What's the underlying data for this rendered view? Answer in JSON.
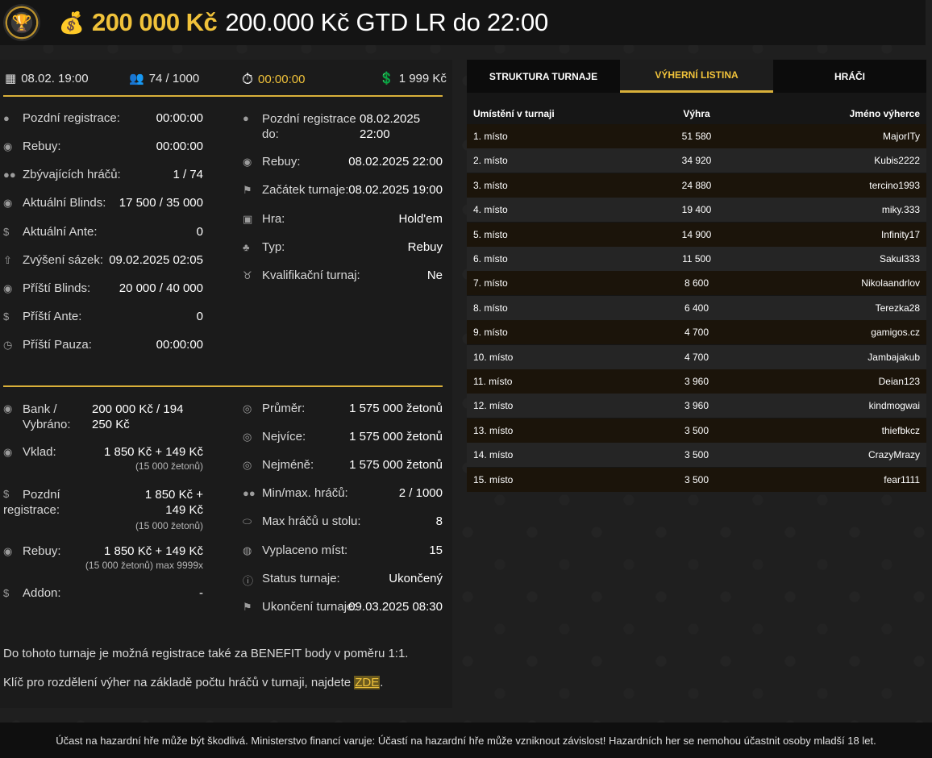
{
  "header": {
    "prize": "200 000 Kč",
    "name": "200.000 Kč GTD LR do 22:00"
  },
  "top": {
    "date": "08.02. 19:00",
    "players": "74 / 1000",
    "timer": "00:00:00",
    "buyin": "1 999 Kč"
  },
  "col1": [
    {
      "label": "Pozdní registrace:",
      "value": "00:00:00",
      "icon": "user-icon"
    },
    {
      "label": "Rebuy:",
      "value": "00:00:00",
      "icon": "coins-icon"
    },
    {
      "label": "Zbývajících hráčů:",
      "value": "1 / 74",
      "icon": "users-icon"
    },
    {
      "label": "Aktuální Blinds:",
      "value": "17 500 / 35 000",
      "icon": "coins-icon"
    },
    {
      "label": "Aktuální Ante:",
      "value": "0",
      "icon": "dollar-icon"
    },
    {
      "label": "Zvýšení sázek:",
      "value": "09.02.2025 02:05",
      "icon": "arrow-up-icon"
    },
    {
      "label": "Příští Blinds:",
      "value": "20 000 / 40 000",
      "icon": "coins-icon"
    },
    {
      "label": "Příští Ante:",
      "value": "0",
      "icon": "dollar-icon"
    },
    {
      "label": "Příští Pauza:",
      "value": "00:00:00",
      "icon": "clock-icon"
    }
  ],
  "col2": [
    {
      "label": "Pozdní registrace do:",
      "value": "08.02.2025 22:00",
      "icon": "user-icon"
    },
    {
      "label": "Rebuy:",
      "value": "08.02.2025 22:00",
      "icon": "coins-icon"
    },
    {
      "label": "Začátek turnaje:",
      "value": "08.02.2025 19:00",
      "icon": "flag-icon"
    },
    {
      "label": "Hra:",
      "value": "Hold'em",
      "icon": "cards-icon"
    },
    {
      "label": "Typ:",
      "value": "Rebuy",
      "icon": "suits-icon"
    },
    {
      "label": "Kvalifikační turnaj:",
      "value": "Ne",
      "icon": "medal-icon"
    }
  ],
  "bottom1": {
    "bank_label": "Bank / Vybráno:",
    "bank_value": "200 000 Kč / 194 250 Kč",
    "vklad_label": "Vklad:",
    "vklad_value": "1 850 Kč + 149 Kč",
    "vklad_sub": "(15 000 žetonů)",
    "late_label": "Pozdní registrace:",
    "late_value": "1 850 Kč + 149 Kč",
    "late_sub": "(15 000 žetonů)",
    "rebuy_label": "Rebuy:",
    "rebuy_value": "1 850 Kč + 149 Kč",
    "rebuy_sub": "(15 000 žetonů) max 9999x",
    "addon_label": "Addon:",
    "addon_value": "-"
  },
  "bottom2": [
    {
      "label": "Průměr:",
      "value": "1 575 000 žetonů",
      "icon": "chip-icon"
    },
    {
      "label": "Nejvíce:",
      "value": "1 575 000 žetonů",
      "icon": "chip-icon"
    },
    {
      "label": "Nejméně:",
      "value": "1 575 000 žetonů",
      "icon": "chip-icon"
    },
    {
      "label": "Min/max. hráčů:",
      "value": "2 / 1000",
      "icon": "users-icon"
    },
    {
      "label": "Max hráčů u stolu:",
      "value": "8",
      "icon": "table-icon"
    },
    {
      "label": "Vyplaceno míst:",
      "value": "15",
      "icon": "payout-icon"
    },
    {
      "label": "Status turnaje:",
      "value": "Ukončený",
      "icon": "info-icon"
    },
    {
      "label": "Ukončení turnaje:",
      "value": "09.03.2025 08:30",
      "icon": "flag-icon"
    }
  ],
  "notes": {
    "benefit": "Do tohoto turnaje je možná registrace také za BENEFIT body v poměru 1:1.",
    "key_prefix": "Klíč pro rozdělení výher na základě počtu hráčů v turnaji, najdete ",
    "key_link": "ZDE",
    "key_suffix": "."
  },
  "tabs": [
    "STRUKTURA TURNAJE",
    "VÝHERNÍ LISTINA",
    "HRÁČI"
  ],
  "results": {
    "headers": [
      "Umístění v turnaji",
      "Výhra",
      "Jméno výherce"
    ],
    "rows": [
      [
        "1. místo",
        "51 580",
        "MajorITy"
      ],
      [
        "2. místo",
        "34 920",
        "Kubis2222"
      ],
      [
        "3. místo",
        "24 880",
        "tercino1993"
      ],
      [
        "4. místo",
        "19 400",
        "miky.333"
      ],
      [
        "5. místo",
        "14 900",
        "Infinity17"
      ],
      [
        "6. místo",
        "11 500",
        "Sakul333"
      ],
      [
        "7. místo",
        "8 600",
        "Nikolaandrlov"
      ],
      [
        "8. místo",
        "6 400",
        "Terezka28"
      ],
      [
        "9. místo",
        "4 700",
        "gamigos.cz"
      ],
      [
        "10. místo",
        "4 700",
        "Jambajakub"
      ],
      [
        "11. místo",
        "3 960",
        "Deian123"
      ],
      [
        "12. místo",
        "3 960",
        "kindmogwai"
      ],
      [
        "13. místo",
        "3 500",
        "thiefbkcz"
      ],
      [
        "14. místo",
        "3 500",
        "CrazyMrazy"
      ],
      [
        "15. místo",
        "3 500",
        "fear1111"
      ]
    ]
  },
  "footer": "Účast na hazardní hře může být škodlivá. Ministerstvo financí varuje: Účastí na hazardní hře může vzniknout závislost! Hazardních her se nemohou účastnit osoby mladší 18 let."
}
